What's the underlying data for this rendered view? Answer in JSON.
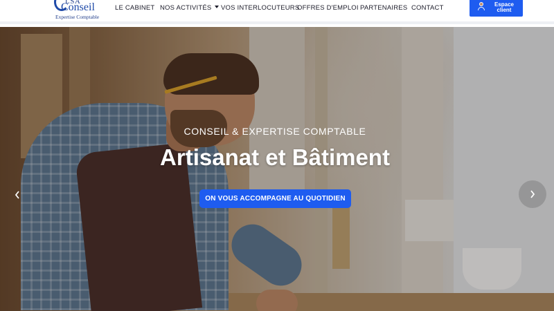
{
  "brand": {
    "logo_text_top": "LSA",
    "logo_text_main": "Conseil",
    "logo_text_sub": "Expertise Comptable",
    "accent_color": "#1e5cf0"
  },
  "nav": {
    "items": [
      {
        "label": "LE CABINET"
      },
      {
        "label": "NOS ACTIVITÉS",
        "has_dropdown": true
      },
      {
        "label": "VOS INTERLOCUTEURS"
      },
      {
        "label": "OFFRES D'EMPLOI"
      },
      {
        "label": "PARTENAIRES"
      },
      {
        "label": "CONTACT"
      }
    ],
    "espace_client": {
      "line1": "Espace",
      "line2": "client",
      "icon": "user-icon"
    }
  },
  "hero": {
    "eyebrow": "CONSEIL & EXPERTISE COMPTABLE",
    "title": "Artisanat et Bâtiment",
    "cta_label": "ON VOUS ACCOMPAGNE AU QUOTIDIEN",
    "prev_icon": "chevron-left-icon",
    "next_icon": "chevron-right-icon"
  }
}
